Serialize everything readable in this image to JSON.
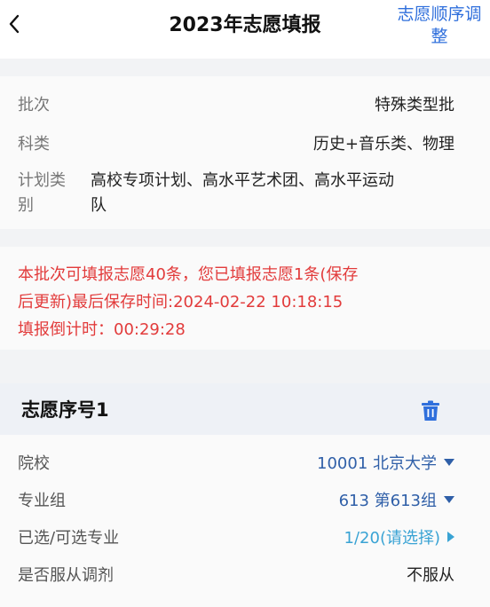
{
  "header": {
    "title": "2023年志愿填报",
    "adjust_line1": "志愿顺序调",
    "adjust_line2": "整"
  },
  "info": {
    "batch_label": "批次",
    "batch_value": "特殊类型批",
    "subject_label": "科类",
    "subject_value": "历史+音乐类、物理",
    "plan_label_line1": "计划类",
    "plan_label_line2": "别",
    "plan_value_line1": "高校专项计划、高水平艺术团、高水平运动",
    "plan_value_line2": "队"
  },
  "notice": {
    "line1": "本批次可填报志愿40条，您已填报志愿1条(保存",
    "line2": "后更新)最后保存时间:2024-02-22 10:18:15",
    "line3": "填报倒计时：00:29:28"
  },
  "card": {
    "title": "志愿序号1",
    "school_label": "院校",
    "school_value": "10001 北京大学",
    "group_label": "专业组",
    "group_value": "613 第613组",
    "major_label": "已选/可选专业",
    "major_value": "1/20(请选择)",
    "adjust_label": "是否服从调剂",
    "adjust_value": "不服从"
  },
  "colors": {
    "accent": "#2f6fdc",
    "link": "#2f5fa8",
    "cyan": "#39a3d4",
    "warning": "#e23b3b"
  }
}
